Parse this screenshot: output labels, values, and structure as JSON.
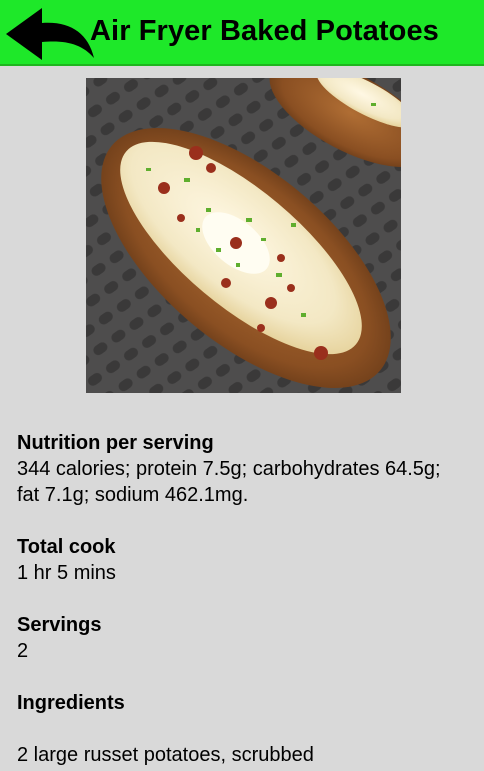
{
  "header": {
    "title": "Air Fryer Baked Potatoes",
    "back_icon": "back-arrow-icon",
    "background_color": "#1ee829"
  },
  "image": {
    "subject": "food-photo"
  },
  "sections": {
    "nutrition": {
      "heading": "Nutrition per serving",
      "text": "344 calories; protein 7.5g; carbohydrates 64.5g; fat 7.1g; sodium 462.1mg."
    },
    "total_cook": {
      "heading": "Total cook",
      "text": "1 hr 5 mins"
    },
    "servings": {
      "heading": "Servings",
      "text": "2"
    },
    "ingredients": {
      "heading": "Ingredients",
      "items": [
        "2 large russet potatoes, scrubbed"
      ]
    }
  }
}
